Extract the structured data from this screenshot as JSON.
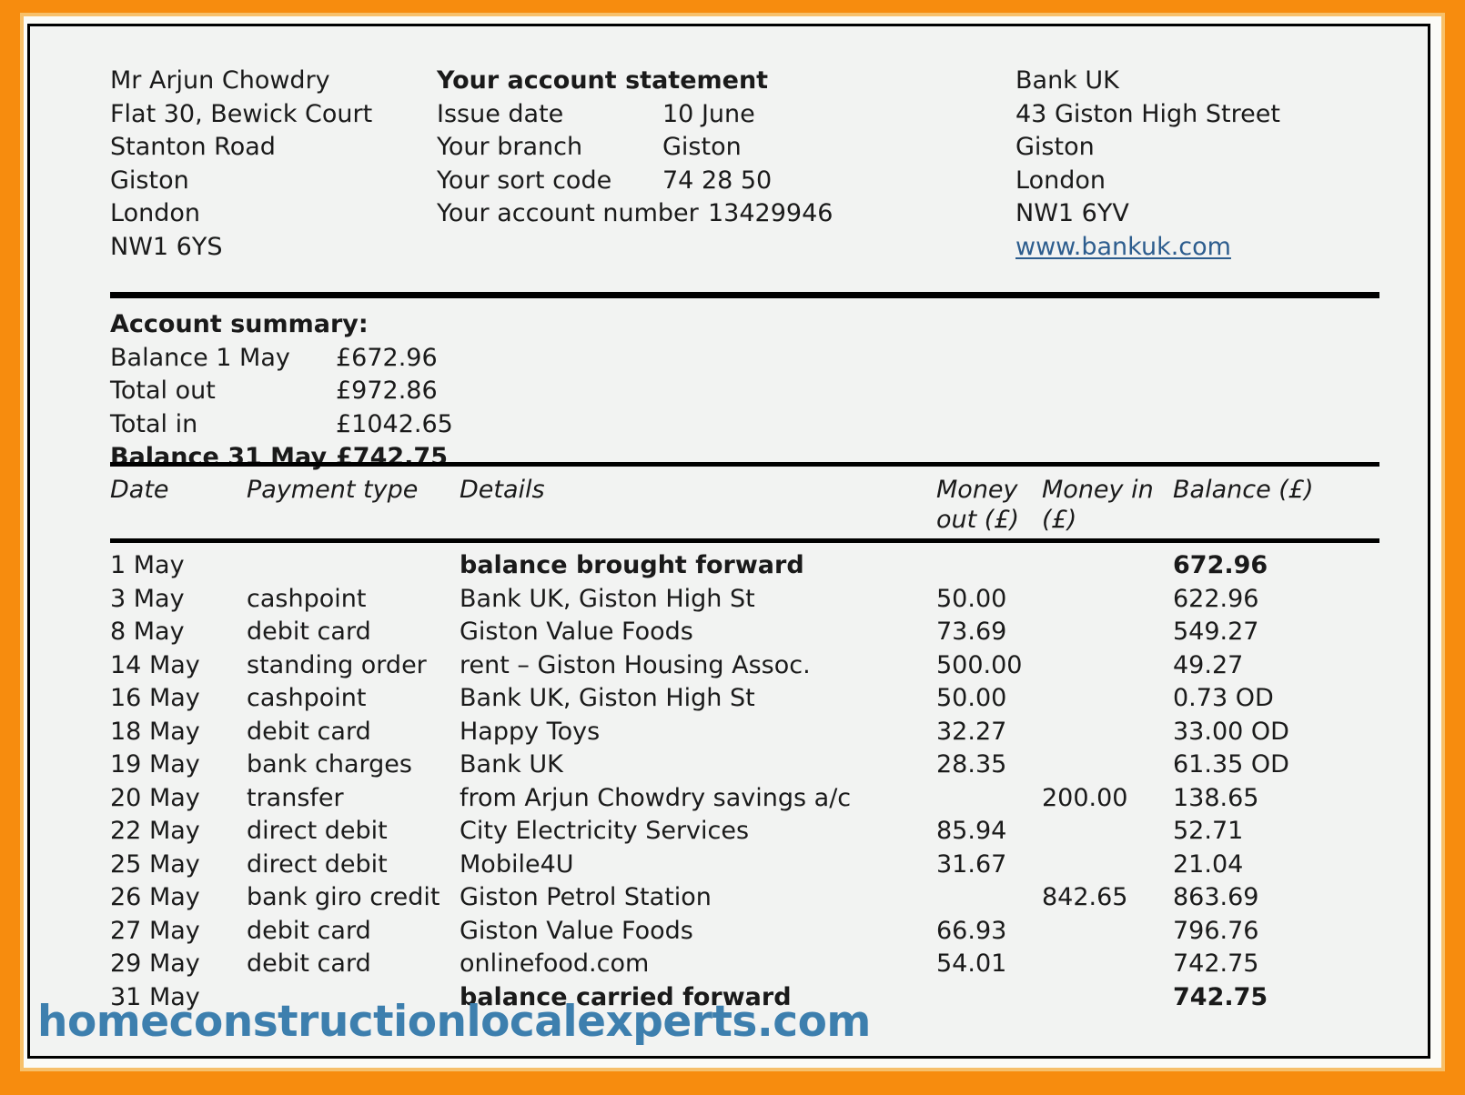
{
  "colors": {
    "frame_orange": "#f78c0e",
    "frame_inner": "#f7c06a",
    "doc_bg": "#f2f3f2",
    "rule": "#000000",
    "link_blue": "#2d5d8e",
    "watermark_blue": "#3d7fae"
  },
  "customer": {
    "name": "Mr Arjun Chowdry",
    "address_line_1": "Flat 30, Bewick Court",
    "address_line_2": "Stanton Road",
    "address_line_3": "Giston",
    "address_line_4": "London",
    "postcode": "NW1 6YS"
  },
  "statement": {
    "title": "Your account statement",
    "fields": [
      {
        "label": "Issue date",
        "value": "10 June"
      },
      {
        "label": "Your branch",
        "value": "Giston"
      },
      {
        "label": "Your sort code",
        "value": "74 28 50"
      },
      {
        "label": "Your account number",
        "value": "13429946"
      }
    ]
  },
  "bank": {
    "name": "Bank UK",
    "address_line_1": "43 Giston High Street",
    "address_line_2": "Giston",
    "address_line_3": "London",
    "postcode": "NW1 6YV",
    "website": "www.bankuk.com"
  },
  "summary": {
    "heading": "Account summary:",
    "rows": [
      {
        "label": "Balance 1 May",
        "amount": "£672.96",
        "bold": false
      },
      {
        "label": "Total out",
        "amount": "£972.86",
        "bold": false
      },
      {
        "label": "Total in",
        "amount": "£1042.65",
        "bold": false
      },
      {
        "label": "Balance 31 May",
        "amount": "£742.75",
        "bold": true
      }
    ]
  },
  "table": {
    "columns": {
      "date": "Date",
      "payment_type": "Payment type",
      "details": "Details",
      "money_out": "Money\nout (£)",
      "money_in": "Money in\n(£)",
      "balance": "Balance (£)"
    },
    "rows": [
      {
        "date": "1 May",
        "type": "",
        "details": "balance brought forward",
        "out": "",
        "in": "",
        "balance": "672.96",
        "bold": true
      },
      {
        "date": "3 May",
        "type": "cashpoint",
        "details": "Bank UK, Giston High St",
        "out": "50.00",
        "in": "",
        "balance": "622.96",
        "bold": false
      },
      {
        "date": "8 May",
        "type": "debit card",
        "details": "Giston Value Foods",
        "out": "73.69",
        "in": "",
        "balance": "549.27",
        "bold": false
      },
      {
        "date": "14 May",
        "type": "standing order",
        "details": "rent – Giston Housing Assoc.",
        "out": "500.00",
        "in": "",
        "balance": "49.27",
        "bold": false
      },
      {
        "date": "16 May",
        "type": "cashpoint",
        "details": "Bank UK, Giston High St",
        "out": "50.00",
        "in": "",
        "balance": "0.73 OD",
        "bold": false
      },
      {
        "date": "18 May",
        "type": "debit card",
        "details": "Happy Toys",
        "out": "32.27",
        "in": "",
        "balance": "33.00 OD",
        "bold": false
      },
      {
        "date": "19 May",
        "type": "bank charges",
        "details": "Bank UK",
        "out": "28.35",
        "in": "",
        "balance": "61.35 OD",
        "bold": false
      },
      {
        "date": "20 May",
        "type": "transfer",
        "details": "from Arjun Chowdry savings a/c",
        "out": "",
        "in": "200.00",
        "balance": "138.65",
        "bold": false
      },
      {
        "date": "22 May",
        "type": "direct debit",
        "details": "City Electricity Services",
        "out": "85.94",
        "in": "",
        "balance": "52.71",
        "bold": false
      },
      {
        "date": "25 May",
        "type": "direct debit",
        "details": "Mobile4U",
        "out": "31.67",
        "in": "",
        "balance": "21.04",
        "bold": false
      },
      {
        "date": "26 May",
        "type": "bank giro credit",
        "details": "Giston Petrol Station",
        "out": "",
        "in": "842.65",
        "balance": "863.69",
        "bold": false
      },
      {
        "date": "27 May",
        "type": "debit card",
        "details": "Giston Value Foods",
        "out": "66.93",
        "in": "",
        "balance": "796.76",
        "bold": false
      },
      {
        "date": "29 May",
        "type": "debit card",
        "details": "onlinefood.com",
        "out": "54.01",
        "in": "",
        "balance": "742.75",
        "bold": false
      },
      {
        "date": "31 May",
        "type": "",
        "details": "balance carried forward",
        "out": "",
        "in": "",
        "balance": "742.75",
        "bold": true
      }
    ]
  },
  "watermark": {
    "text": "homeconstructionlocalexperts.com"
  }
}
